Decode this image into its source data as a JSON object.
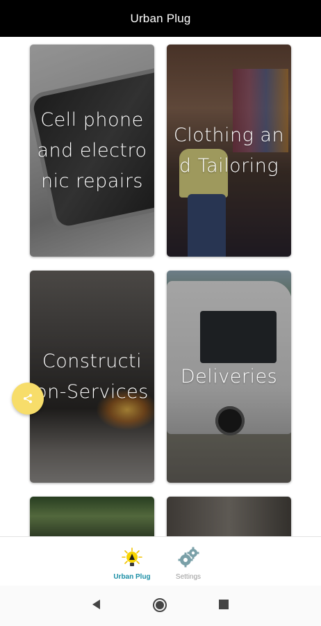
{
  "app": {
    "title": "Urban Plug"
  },
  "categories": [
    {
      "label": "Cell phone and electronic repairs"
    },
    {
      "label": "Clothing and Tailoring"
    },
    {
      "label": "Constructi on-Services"
    },
    {
      "label": "Deliveries"
    }
  ],
  "fab": {
    "icon": "share-icon",
    "color": "#F7DD6A"
  },
  "bottom_nav": {
    "items": [
      {
        "label": "Urban Plug",
        "icon": "urban-plug-logo-icon",
        "active": true
      },
      {
        "label": "Settings",
        "icon": "gears-icon",
        "active": false
      }
    ],
    "active_color": "#1C8FA6"
  },
  "system_nav": {
    "icons": [
      "back-icon",
      "home-icon",
      "recents-icon"
    ]
  }
}
